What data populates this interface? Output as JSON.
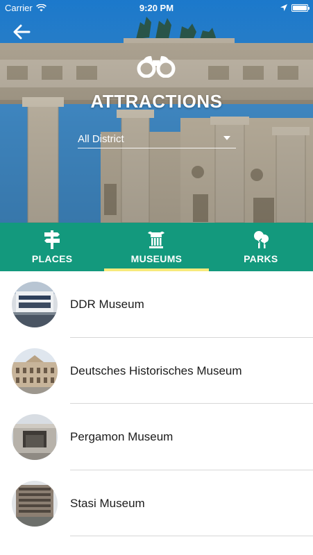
{
  "status": {
    "carrier": "Carrier",
    "time": "9:20 PM"
  },
  "header": {
    "title": "ATTRACTIONS",
    "district_selected": "All District"
  },
  "tabs": [
    {
      "label": "PLACES",
      "icon": "signpost-icon"
    },
    {
      "label": "MUSEUMS",
      "icon": "museum-icon",
      "active": true
    },
    {
      "label": "PARKS",
      "icon": "trees-icon"
    }
  ],
  "museums": [
    {
      "name": "DDR Museum"
    },
    {
      "name": "Deutsches Historisches Museum"
    },
    {
      "name": "Pergamon Museum"
    },
    {
      "name": "Stasi Museum"
    }
  ],
  "colors": {
    "tab_bar": "#13997d",
    "tab_indicator": "#f7ea7b",
    "sky": "#3a98e6"
  }
}
